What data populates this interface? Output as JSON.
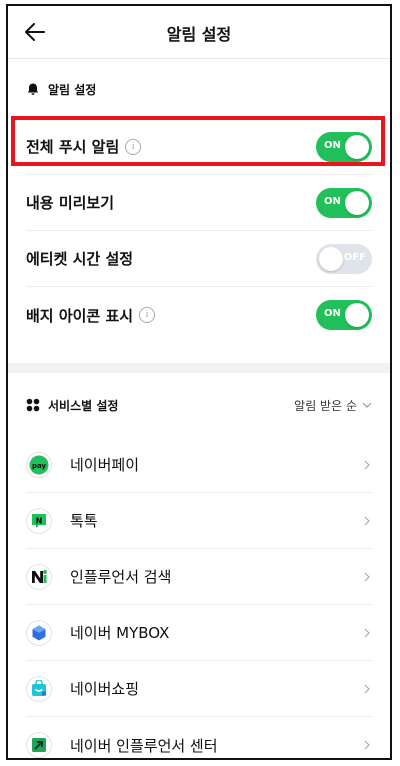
{
  "header": {
    "title": "알림 설정"
  },
  "notifications": {
    "section_title": "알림 설정",
    "items": [
      {
        "label": "전체 푸시 알림",
        "info": true,
        "state": "ON",
        "on": true
      },
      {
        "label": "내용 미리보기",
        "info": false,
        "state": "ON",
        "on": true
      },
      {
        "label": "에티켓 시간 설정",
        "info": false,
        "state": "OFF",
        "on": false
      },
      {
        "label": "배지 아이콘 표시",
        "info": true,
        "state": "ON",
        "on": true
      }
    ]
  },
  "services": {
    "section_title": "서비스별 설정",
    "sort_label": "알림 받은 순",
    "items": [
      {
        "label": "네이버페이",
        "icon": "naver-pay-icon"
      },
      {
        "label": "톡톡",
        "icon": "talktalk-icon"
      },
      {
        "label": "인플루언서 검색",
        "icon": "influencer-search-icon"
      },
      {
        "label": "네이버 MYBOX",
        "icon": "mybox-icon"
      },
      {
        "label": "네이버쇼핑",
        "icon": "naver-shopping-icon"
      },
      {
        "label": "네이버 인플루언서 센터",
        "icon": "influencer-center-icon"
      }
    ]
  },
  "icon_texts": {
    "pay": "pay",
    "n": "N"
  },
  "colors": {
    "toggle_on": "#21c05b",
    "toggle_off": "#dfe3ea",
    "highlight": "#e8141e"
  }
}
